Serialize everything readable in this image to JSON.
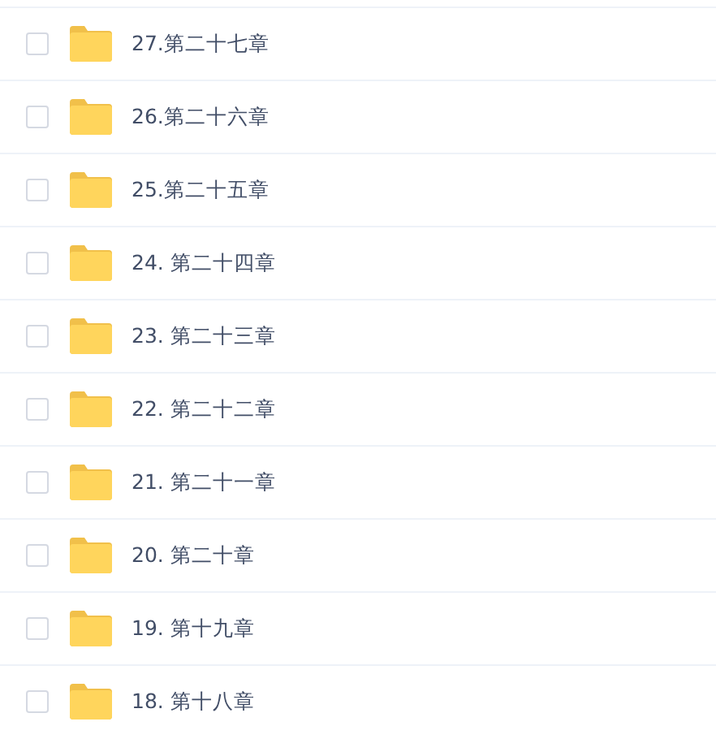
{
  "files": [
    {
      "name": "27.第二十七章",
      "checked": false
    },
    {
      "name": "26.第二十六章",
      "checked": false
    },
    {
      "name": "25.第二十五章",
      "checked": false
    },
    {
      "name": "24. 第二十四章",
      "checked": false
    },
    {
      "name": "23. 第二十三章",
      "checked": false
    },
    {
      "name": "22. 第二十二章",
      "checked": false
    },
    {
      "name": "21. 第二十一章",
      "checked": false
    },
    {
      "name": "20. 第二十章",
      "checked": false
    },
    {
      "name": "19. 第十九章",
      "checked": false
    },
    {
      "name": "18. 第十八章",
      "checked": false
    }
  ]
}
